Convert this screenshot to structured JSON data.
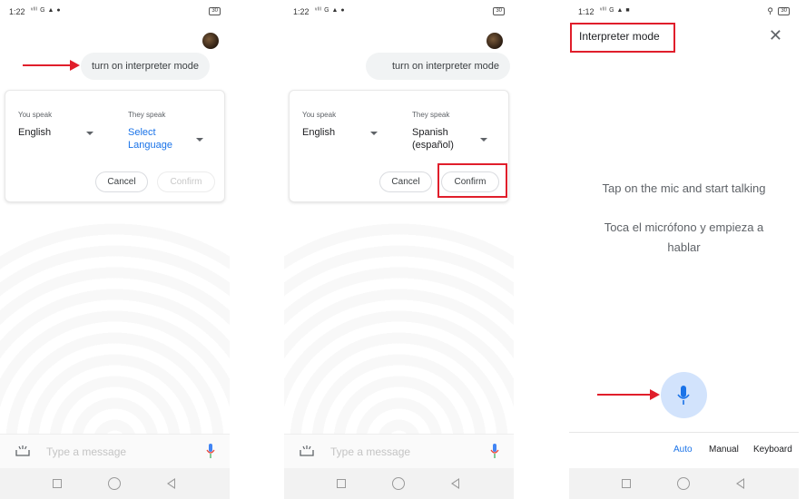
{
  "panel1": {
    "status": {
      "time": "1:22",
      "icons": "ᵛᴵˡˡ G ▲ ●",
      "battery": "30"
    },
    "chat_bubble": "turn on interpreter mode",
    "card": {
      "you_speak_label": "You speak",
      "you_speak_value": "English",
      "they_speak_label": "They speak",
      "they_speak_value": "Select\nLanguage",
      "cancel": "Cancel",
      "confirm": "Confirm"
    },
    "input_placeholder": "Type a message"
  },
  "panel2": {
    "status": {
      "time": "1:22",
      "icons": "ᵛᴵˡˡ G ▲ ●",
      "battery": "30"
    },
    "chat_bubble": "turn on interpreter mode",
    "card": {
      "you_speak_label": "You speak",
      "you_speak_value": "English",
      "they_speak_label": "They speak",
      "they_speak_value": "Spanish\n(español)",
      "cancel": "Cancel",
      "confirm": "Confirm"
    },
    "input_placeholder": "Type a message"
  },
  "panel3": {
    "status": {
      "time": "1:12",
      "icons": "ᵛᴵˡˡ G ▲ ■",
      "battery": "30",
      "location_icon": "⚲"
    },
    "title": "Interpreter mode",
    "close": "✕",
    "prompt_en": "Tap on the mic and start talking",
    "prompt_es": "Toca el micrófono y empieza a hablar",
    "modes": [
      "Auto",
      "Manual",
      "Keyboard"
    ]
  },
  "colors": {
    "highlight": "#e01e2b",
    "accent": "#1a73e8"
  }
}
